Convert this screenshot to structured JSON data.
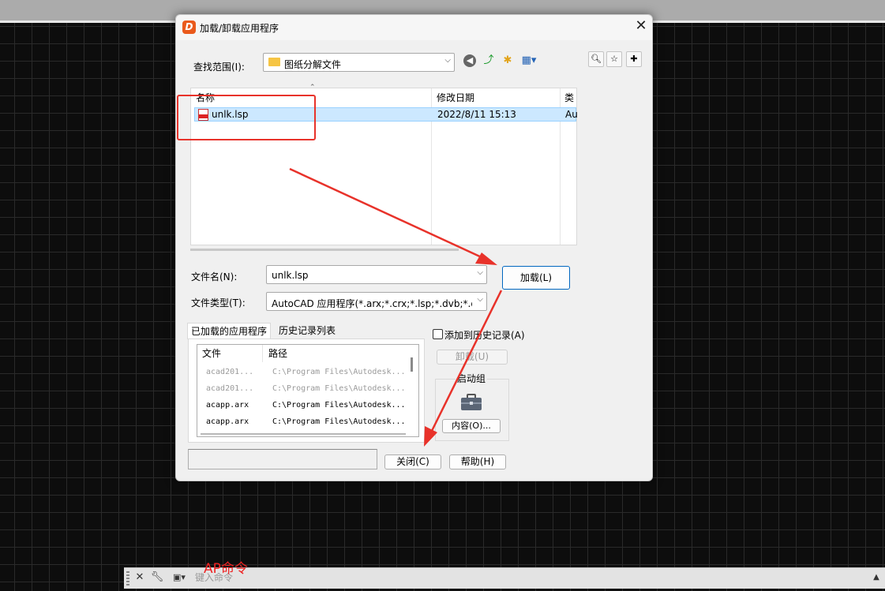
{
  "dialog": {
    "title": "加载/卸载应用程序",
    "close_icon": "close-icon"
  },
  "lookin": {
    "label": "查找范围(I):",
    "value": "图纸分解文件"
  },
  "file_list": {
    "columns": [
      "名称",
      "修改日期",
      "类"
    ],
    "rows": [
      {
        "name": "unlk.lsp",
        "date": "2022/8/11 15:13",
        "type": "Au"
      }
    ]
  },
  "filename": {
    "label": "文件名(N):",
    "value": "unlk.lsp"
  },
  "filetype": {
    "label": "文件类型(T):",
    "value": "AutoCAD 应用程序(*.arx;*.crx;*.lsp;*.dvb;*.dbx"
  },
  "buttons": {
    "load": "加载(L)",
    "unload": "卸载(U)",
    "contents": "内容(O)...",
    "close": "关闭(C)",
    "help": "帮助(H)"
  },
  "tabs": [
    "已加载的应用程序",
    "历史记录列表"
  ],
  "history_checkbox": "添加到历史记录(A)",
  "startup_group": "启动组",
  "app_table": {
    "columns": [
      "文件",
      "路径"
    ],
    "rows": [
      {
        "file": "acad201...",
        "path": "C:\\Program Files\\Autodesk...",
        "dim": true
      },
      {
        "file": "acad201...",
        "path": "C:\\Program Files\\Autodesk...",
        "dim": true
      },
      {
        "file": "acapp.arx",
        "path": "C:\\Program Files\\Autodesk...",
        "dim": false
      },
      {
        "file": "acapp.arx",
        "path": "C:\\Program Files\\Autodesk...",
        "dim": false
      }
    ]
  },
  "command_line": {
    "placeholder": "键入命令"
  },
  "annotation": {
    "label": "AP命令",
    "color": "#ee2222"
  }
}
